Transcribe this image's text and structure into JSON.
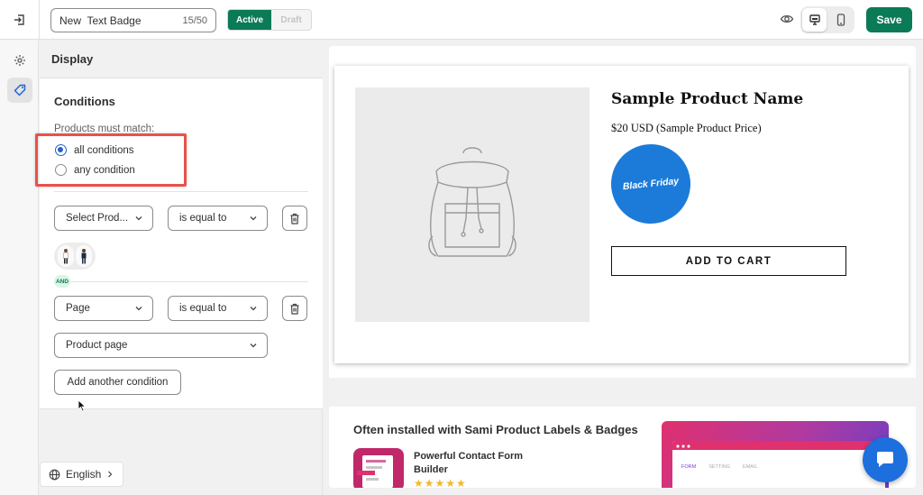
{
  "topbar": {
    "exit_icon": "exit-icon",
    "badge_name_value": "New  Text Badge",
    "badge_name_count": "15/50",
    "status_active": "Active",
    "status_draft": "Draft",
    "preview_icon": "eye-icon",
    "desktop_icon": "desktop-icon",
    "mobile_icon": "mobile-icon",
    "save_label": "Save",
    "accent_color": "#0b7a57"
  },
  "rail": {
    "items": [
      {
        "icon": "gear-icon"
      },
      {
        "icon": "tag-icon",
        "selected": true
      }
    ]
  },
  "panel": {
    "header": "Display",
    "conditions_title": "Conditions",
    "match_label": "Products must match:",
    "match_options": [
      "all conditions",
      "any condition"
    ],
    "match_selected": "all conditions",
    "conditions": [
      {
        "field": "Select Prod...",
        "operator": "is equal to"
      },
      {
        "field": "Page",
        "operator": "is equal to",
        "value": "Product page"
      }
    ],
    "and_label": "AND",
    "add_condition_label": "Add another condition",
    "language_label": "English"
  },
  "preview": {
    "product_name": "Sample Product Name",
    "product_price": "$20 USD (Sample Product Price)",
    "badge_text": "Black Friday",
    "badge_color": "#1c7bd8",
    "add_to_cart": "ADD TO CART",
    "often_title": "Often installed with Sami Product Labels & Badges",
    "app_name": "Powerful Contact Form Builder",
    "app_stars": "★★★★★",
    "promo_tabs": [
      "FORM",
      "SETTING",
      "EMAIL"
    ]
  }
}
